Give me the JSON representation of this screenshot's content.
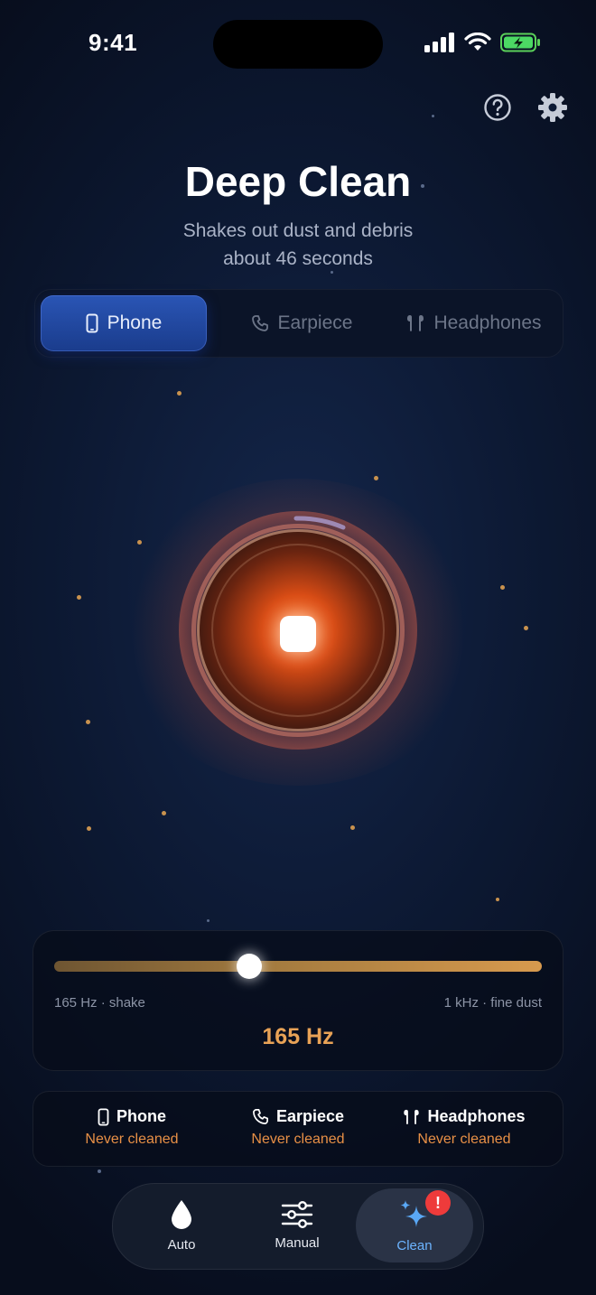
{
  "status_bar": {
    "time": "9:41"
  },
  "header": {
    "title": "Deep Clean",
    "subtitle_line1": "Shakes out dust and debris",
    "subtitle_line2": "about 46 seconds"
  },
  "segments": [
    {
      "label": "Phone",
      "icon": "phone-icon",
      "selected": true
    },
    {
      "label": "Earpiece",
      "icon": "earpiece-icon",
      "selected": false
    },
    {
      "label": "Headphones",
      "icon": "headphones-icon",
      "selected": false
    }
  ],
  "frequency": {
    "min_label": "165 Hz · shake",
    "max_label": "1 kHz · fine dust",
    "value_label": "165 Hz",
    "slider_fraction": 0.4
  },
  "devices": [
    {
      "name": "Phone",
      "status": "Never cleaned"
    },
    {
      "name": "Earpiece",
      "status": "Never cleaned"
    },
    {
      "name": "Headphones",
      "status": "Never cleaned"
    }
  ],
  "tabs": [
    {
      "label": "Auto",
      "icon": "water-drop-icon"
    },
    {
      "label": "Manual",
      "icon": "sliders-icon"
    },
    {
      "label": "Clean",
      "icon": "sparkles-icon",
      "active": true
    }
  ],
  "badge": {
    "label": "!"
  },
  "colors": {
    "accent_orange": "#e8a256",
    "active_tab_blue": "#6cb4ff",
    "segment_active": "#2a55b5",
    "badge_red": "#ee3b3b"
  }
}
